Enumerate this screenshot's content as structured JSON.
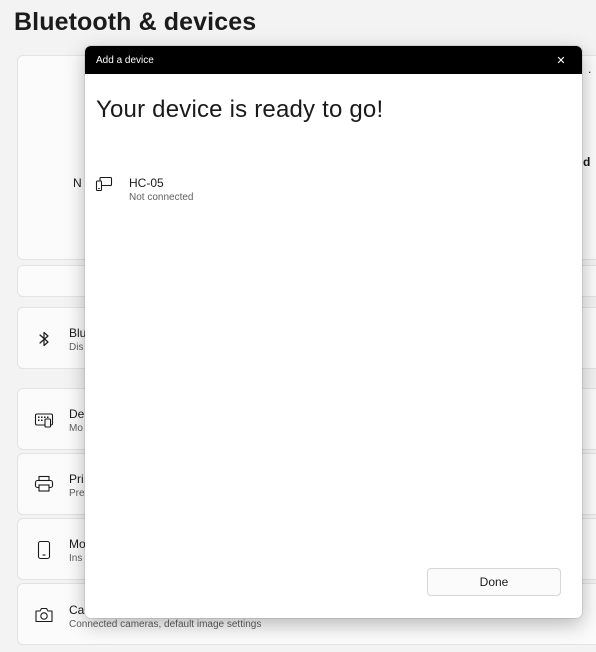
{
  "page": {
    "title": "Bluetooth & devices"
  },
  "background": {
    "truncated_left_text": "N",
    "truncated_right_text": "d",
    "overflow_dot": ".",
    "rows": [
      {
        "icon": "bluetooth-icon",
        "title": "Blu",
        "subtitle": "Dis"
      },
      {
        "icon": "keyboard-icon",
        "title": "De",
        "subtitle": "Mo"
      },
      {
        "icon": "printer-icon",
        "title": "Pri",
        "subtitle": "Pre"
      },
      {
        "icon": "phone-icon",
        "title": "Mo",
        "subtitle": "Ins"
      },
      {
        "icon": "camera-icon",
        "title": "Ca",
        "subtitle": "Connected cameras, default image settings"
      }
    ]
  },
  "dialog": {
    "window_title": "Add a device",
    "close_glyph": "✕",
    "heading": "Your device is ready to go!",
    "device": {
      "icon": "device-icon",
      "name": "HC-05",
      "status": "Not connected"
    },
    "done_label": "Done"
  }
}
